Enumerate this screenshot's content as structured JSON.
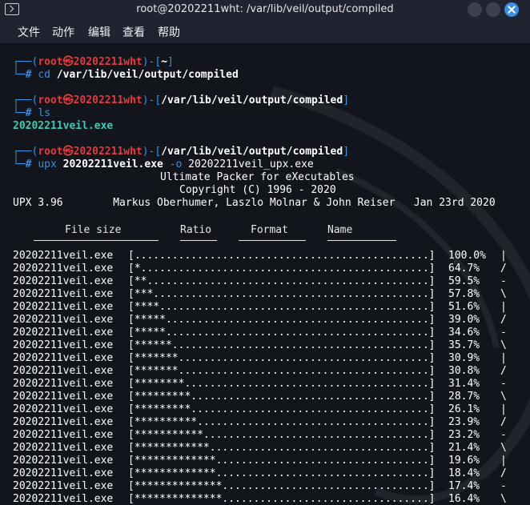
{
  "window": {
    "title": "root@20202211wht: /var/lib/veil/output/compiled"
  },
  "menu": [
    "文件",
    "动作",
    "编辑",
    "查看",
    "帮助"
  ],
  "prompt": {
    "user": "root",
    "sep": "㉿",
    "host": "20202211wht",
    "hash": "#"
  },
  "commands": [
    {
      "dir": "~",
      "cmd": "cd",
      "args": "/var/lib/veil/output/compiled"
    },
    {
      "dir": "/var/lib/veil/output/compiled",
      "cmd": "ls",
      "args": ""
    },
    {
      "dir": "/var/lib/veil/output/compiled",
      "cmd": "upx",
      "args": "20202211veil.exe",
      "opt": "-o",
      "args2": "20202211veil_upx.exe"
    }
  ],
  "ls_output": "20202211veil.exe",
  "upx": {
    "title": "Ultimate Packer for eXecutables",
    "copyright": "Copyright (C) 1996 - 2020",
    "version_line": "UPX 3.96        Markus Oberhumer, Laszlo Molnar & John Reiser   Jan 23rd 2020",
    "headers": [
      "File size",
      "Ratio",
      "Format",
      "Name"
    ]
  },
  "progress_rows": [
    {
      "name": "20202211veil.exe",
      "bar": "[...............................................]",
      "pct": "100.0%",
      "spin": "|"
    },
    {
      "name": "20202211veil.exe",
      "bar": "[*..............................................]",
      "pct": "64.7%",
      "spin": "/"
    },
    {
      "name": "20202211veil.exe",
      "bar": "[**.............................................]",
      "pct": "59.5%",
      "spin": "-"
    },
    {
      "name": "20202211veil.exe",
      "bar": "[***............................................]",
      "pct": "57.8%",
      "spin": "\\"
    },
    {
      "name": "20202211veil.exe",
      "bar": "[****...........................................]",
      "pct": "51.6%",
      "spin": "|"
    },
    {
      "name": "20202211veil.exe",
      "bar": "[*****..........................................]",
      "pct": "39.0%",
      "spin": "/"
    },
    {
      "name": "20202211veil.exe",
      "bar": "[*****..........................................]",
      "pct": "34.6%",
      "spin": "-"
    },
    {
      "name": "20202211veil.exe",
      "bar": "[******.........................................]",
      "pct": "35.7%",
      "spin": "\\"
    },
    {
      "name": "20202211veil.exe",
      "bar": "[*******........................................]",
      "pct": "30.9%",
      "spin": "|"
    },
    {
      "name": "20202211veil.exe",
      "bar": "[*******........................................]",
      "pct": "30.8%",
      "spin": "/"
    },
    {
      "name": "20202211veil.exe",
      "bar": "[********.......................................]",
      "pct": "31.4%",
      "spin": "-"
    },
    {
      "name": "20202211veil.exe",
      "bar": "[*********......................................]",
      "pct": "28.7%",
      "spin": "\\"
    },
    {
      "name": "20202211veil.exe",
      "bar": "[*********......................................]",
      "pct": "26.1%",
      "spin": "|"
    },
    {
      "name": "20202211veil.exe",
      "bar": "[**********.....................................]",
      "pct": "23.9%",
      "spin": "/"
    },
    {
      "name": "20202211veil.exe",
      "bar": "[***********....................................]",
      "pct": "23.2%",
      "spin": "-"
    },
    {
      "name": "20202211veil.exe",
      "bar": "[************...................................]",
      "pct": "21.4%",
      "spin": "\\"
    },
    {
      "name": "20202211veil.exe",
      "bar": "[*************..................................]",
      "pct": "19.6%",
      "spin": "|"
    },
    {
      "name": "20202211veil.exe",
      "bar": "[*************..................................]",
      "pct": "18.4%",
      "spin": "/"
    },
    {
      "name": "20202211veil.exe",
      "bar": "[**************.................................]",
      "pct": "17.4%",
      "spin": "-"
    },
    {
      "name": "20202211veil.exe",
      "bar": "[**************.................................]",
      "pct": "16.4%",
      "spin": "\\"
    }
  ],
  "colors": {
    "prompt_frame": "#3a8ee6",
    "user_host": "#e23c3c",
    "ls_file": "#3ccab6",
    "close_button": "#3a8ee6"
  }
}
